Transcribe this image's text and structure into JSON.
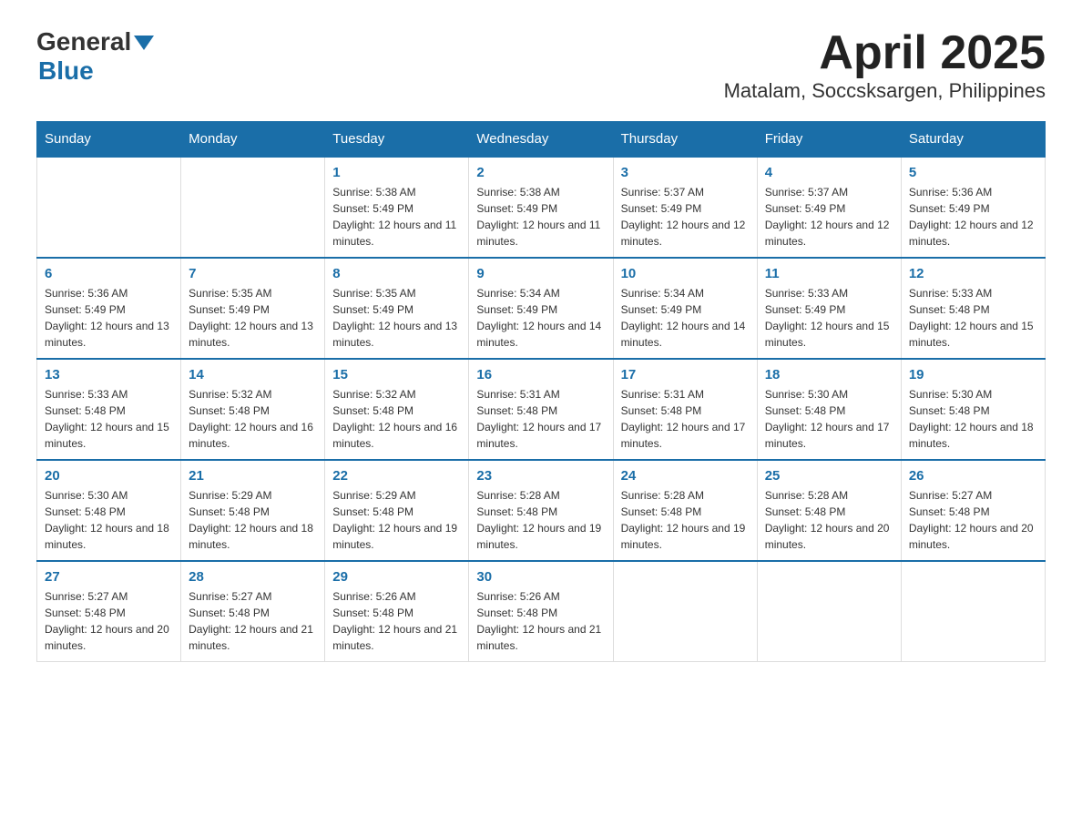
{
  "header": {
    "logo_general": "General",
    "logo_blue": "Blue",
    "title": "April 2025",
    "subtitle": "Matalam, Soccsksargen, Philippines"
  },
  "weekdays": [
    "Sunday",
    "Monday",
    "Tuesday",
    "Wednesday",
    "Thursday",
    "Friday",
    "Saturday"
  ],
  "weeks": [
    [
      {
        "day": "",
        "sunrise": "",
        "sunset": "",
        "daylight": ""
      },
      {
        "day": "",
        "sunrise": "",
        "sunset": "",
        "daylight": ""
      },
      {
        "day": "1",
        "sunrise": "Sunrise: 5:38 AM",
        "sunset": "Sunset: 5:49 PM",
        "daylight": "Daylight: 12 hours and 11 minutes."
      },
      {
        "day": "2",
        "sunrise": "Sunrise: 5:38 AM",
        "sunset": "Sunset: 5:49 PM",
        "daylight": "Daylight: 12 hours and 11 minutes."
      },
      {
        "day": "3",
        "sunrise": "Sunrise: 5:37 AM",
        "sunset": "Sunset: 5:49 PM",
        "daylight": "Daylight: 12 hours and 12 minutes."
      },
      {
        "day": "4",
        "sunrise": "Sunrise: 5:37 AM",
        "sunset": "Sunset: 5:49 PM",
        "daylight": "Daylight: 12 hours and 12 minutes."
      },
      {
        "day": "5",
        "sunrise": "Sunrise: 5:36 AM",
        "sunset": "Sunset: 5:49 PM",
        "daylight": "Daylight: 12 hours and 12 minutes."
      }
    ],
    [
      {
        "day": "6",
        "sunrise": "Sunrise: 5:36 AM",
        "sunset": "Sunset: 5:49 PM",
        "daylight": "Daylight: 12 hours and 13 minutes."
      },
      {
        "day": "7",
        "sunrise": "Sunrise: 5:35 AM",
        "sunset": "Sunset: 5:49 PM",
        "daylight": "Daylight: 12 hours and 13 minutes."
      },
      {
        "day": "8",
        "sunrise": "Sunrise: 5:35 AM",
        "sunset": "Sunset: 5:49 PM",
        "daylight": "Daylight: 12 hours and 13 minutes."
      },
      {
        "day": "9",
        "sunrise": "Sunrise: 5:34 AM",
        "sunset": "Sunset: 5:49 PM",
        "daylight": "Daylight: 12 hours and 14 minutes."
      },
      {
        "day": "10",
        "sunrise": "Sunrise: 5:34 AM",
        "sunset": "Sunset: 5:49 PM",
        "daylight": "Daylight: 12 hours and 14 minutes."
      },
      {
        "day": "11",
        "sunrise": "Sunrise: 5:33 AM",
        "sunset": "Sunset: 5:49 PM",
        "daylight": "Daylight: 12 hours and 15 minutes."
      },
      {
        "day": "12",
        "sunrise": "Sunrise: 5:33 AM",
        "sunset": "Sunset: 5:48 PM",
        "daylight": "Daylight: 12 hours and 15 minutes."
      }
    ],
    [
      {
        "day": "13",
        "sunrise": "Sunrise: 5:33 AM",
        "sunset": "Sunset: 5:48 PM",
        "daylight": "Daylight: 12 hours and 15 minutes."
      },
      {
        "day": "14",
        "sunrise": "Sunrise: 5:32 AM",
        "sunset": "Sunset: 5:48 PM",
        "daylight": "Daylight: 12 hours and 16 minutes."
      },
      {
        "day": "15",
        "sunrise": "Sunrise: 5:32 AM",
        "sunset": "Sunset: 5:48 PM",
        "daylight": "Daylight: 12 hours and 16 minutes."
      },
      {
        "day": "16",
        "sunrise": "Sunrise: 5:31 AM",
        "sunset": "Sunset: 5:48 PM",
        "daylight": "Daylight: 12 hours and 17 minutes."
      },
      {
        "day": "17",
        "sunrise": "Sunrise: 5:31 AM",
        "sunset": "Sunset: 5:48 PM",
        "daylight": "Daylight: 12 hours and 17 minutes."
      },
      {
        "day": "18",
        "sunrise": "Sunrise: 5:30 AM",
        "sunset": "Sunset: 5:48 PM",
        "daylight": "Daylight: 12 hours and 17 minutes."
      },
      {
        "day": "19",
        "sunrise": "Sunrise: 5:30 AM",
        "sunset": "Sunset: 5:48 PM",
        "daylight": "Daylight: 12 hours and 18 minutes."
      }
    ],
    [
      {
        "day": "20",
        "sunrise": "Sunrise: 5:30 AM",
        "sunset": "Sunset: 5:48 PM",
        "daylight": "Daylight: 12 hours and 18 minutes."
      },
      {
        "day": "21",
        "sunrise": "Sunrise: 5:29 AM",
        "sunset": "Sunset: 5:48 PM",
        "daylight": "Daylight: 12 hours and 18 minutes."
      },
      {
        "day": "22",
        "sunrise": "Sunrise: 5:29 AM",
        "sunset": "Sunset: 5:48 PM",
        "daylight": "Daylight: 12 hours and 19 minutes."
      },
      {
        "day": "23",
        "sunrise": "Sunrise: 5:28 AM",
        "sunset": "Sunset: 5:48 PM",
        "daylight": "Daylight: 12 hours and 19 minutes."
      },
      {
        "day": "24",
        "sunrise": "Sunrise: 5:28 AM",
        "sunset": "Sunset: 5:48 PM",
        "daylight": "Daylight: 12 hours and 19 minutes."
      },
      {
        "day": "25",
        "sunrise": "Sunrise: 5:28 AM",
        "sunset": "Sunset: 5:48 PM",
        "daylight": "Daylight: 12 hours and 20 minutes."
      },
      {
        "day": "26",
        "sunrise": "Sunrise: 5:27 AM",
        "sunset": "Sunset: 5:48 PM",
        "daylight": "Daylight: 12 hours and 20 minutes."
      }
    ],
    [
      {
        "day": "27",
        "sunrise": "Sunrise: 5:27 AM",
        "sunset": "Sunset: 5:48 PM",
        "daylight": "Daylight: 12 hours and 20 minutes."
      },
      {
        "day": "28",
        "sunrise": "Sunrise: 5:27 AM",
        "sunset": "Sunset: 5:48 PM",
        "daylight": "Daylight: 12 hours and 21 minutes."
      },
      {
        "day": "29",
        "sunrise": "Sunrise: 5:26 AM",
        "sunset": "Sunset: 5:48 PM",
        "daylight": "Daylight: 12 hours and 21 minutes."
      },
      {
        "day": "30",
        "sunrise": "Sunrise: 5:26 AM",
        "sunset": "Sunset: 5:48 PM",
        "daylight": "Daylight: 12 hours and 21 minutes."
      },
      {
        "day": "",
        "sunrise": "",
        "sunset": "",
        "daylight": ""
      },
      {
        "day": "",
        "sunrise": "",
        "sunset": "",
        "daylight": ""
      },
      {
        "day": "",
        "sunrise": "",
        "sunset": "",
        "daylight": ""
      }
    ]
  ]
}
